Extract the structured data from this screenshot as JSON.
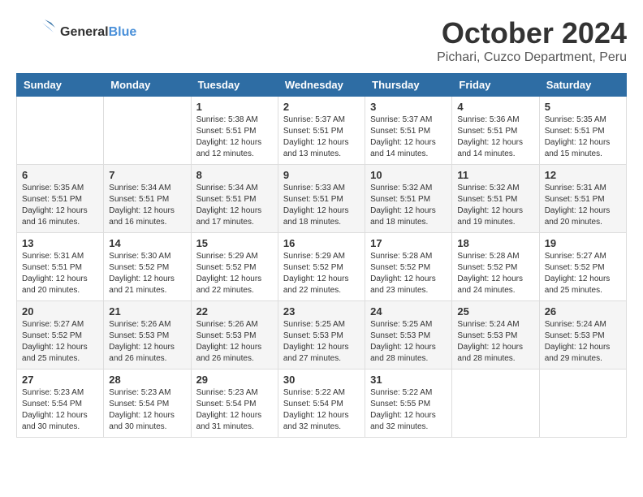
{
  "header": {
    "logo_general": "General",
    "logo_blue": "Blue",
    "month_title": "October 2024",
    "location": "Pichari, Cuzco Department, Peru"
  },
  "days_of_week": [
    "Sunday",
    "Monday",
    "Tuesday",
    "Wednesday",
    "Thursday",
    "Friday",
    "Saturday"
  ],
  "weeks": [
    [
      {
        "day": "",
        "sunrise": "",
        "sunset": "",
        "daylight": ""
      },
      {
        "day": "",
        "sunrise": "",
        "sunset": "",
        "daylight": ""
      },
      {
        "day": "1",
        "sunrise": "Sunrise: 5:38 AM",
        "sunset": "Sunset: 5:51 PM",
        "daylight": "Daylight: 12 hours and 12 minutes."
      },
      {
        "day": "2",
        "sunrise": "Sunrise: 5:37 AM",
        "sunset": "Sunset: 5:51 PM",
        "daylight": "Daylight: 12 hours and 13 minutes."
      },
      {
        "day": "3",
        "sunrise": "Sunrise: 5:37 AM",
        "sunset": "Sunset: 5:51 PM",
        "daylight": "Daylight: 12 hours and 14 minutes."
      },
      {
        "day": "4",
        "sunrise": "Sunrise: 5:36 AM",
        "sunset": "Sunset: 5:51 PM",
        "daylight": "Daylight: 12 hours and 14 minutes."
      },
      {
        "day": "5",
        "sunrise": "Sunrise: 5:35 AM",
        "sunset": "Sunset: 5:51 PM",
        "daylight": "Daylight: 12 hours and 15 minutes."
      }
    ],
    [
      {
        "day": "6",
        "sunrise": "Sunrise: 5:35 AM",
        "sunset": "Sunset: 5:51 PM",
        "daylight": "Daylight: 12 hours and 16 minutes."
      },
      {
        "day": "7",
        "sunrise": "Sunrise: 5:34 AM",
        "sunset": "Sunset: 5:51 PM",
        "daylight": "Daylight: 12 hours and 16 minutes."
      },
      {
        "day": "8",
        "sunrise": "Sunrise: 5:34 AM",
        "sunset": "Sunset: 5:51 PM",
        "daylight": "Daylight: 12 hours and 17 minutes."
      },
      {
        "day": "9",
        "sunrise": "Sunrise: 5:33 AM",
        "sunset": "Sunset: 5:51 PM",
        "daylight": "Daylight: 12 hours and 18 minutes."
      },
      {
        "day": "10",
        "sunrise": "Sunrise: 5:32 AM",
        "sunset": "Sunset: 5:51 PM",
        "daylight": "Daylight: 12 hours and 18 minutes."
      },
      {
        "day": "11",
        "sunrise": "Sunrise: 5:32 AM",
        "sunset": "Sunset: 5:51 PM",
        "daylight": "Daylight: 12 hours and 19 minutes."
      },
      {
        "day": "12",
        "sunrise": "Sunrise: 5:31 AM",
        "sunset": "Sunset: 5:51 PM",
        "daylight": "Daylight: 12 hours and 20 minutes."
      }
    ],
    [
      {
        "day": "13",
        "sunrise": "Sunrise: 5:31 AM",
        "sunset": "Sunset: 5:51 PM",
        "daylight": "Daylight: 12 hours and 20 minutes."
      },
      {
        "day": "14",
        "sunrise": "Sunrise: 5:30 AM",
        "sunset": "Sunset: 5:52 PM",
        "daylight": "Daylight: 12 hours and 21 minutes."
      },
      {
        "day": "15",
        "sunrise": "Sunrise: 5:29 AM",
        "sunset": "Sunset: 5:52 PM",
        "daylight": "Daylight: 12 hours and 22 minutes."
      },
      {
        "day": "16",
        "sunrise": "Sunrise: 5:29 AM",
        "sunset": "Sunset: 5:52 PM",
        "daylight": "Daylight: 12 hours and 22 minutes."
      },
      {
        "day": "17",
        "sunrise": "Sunrise: 5:28 AM",
        "sunset": "Sunset: 5:52 PM",
        "daylight": "Daylight: 12 hours and 23 minutes."
      },
      {
        "day": "18",
        "sunrise": "Sunrise: 5:28 AM",
        "sunset": "Sunset: 5:52 PM",
        "daylight": "Daylight: 12 hours and 24 minutes."
      },
      {
        "day": "19",
        "sunrise": "Sunrise: 5:27 AM",
        "sunset": "Sunset: 5:52 PM",
        "daylight": "Daylight: 12 hours and 25 minutes."
      }
    ],
    [
      {
        "day": "20",
        "sunrise": "Sunrise: 5:27 AM",
        "sunset": "Sunset: 5:52 PM",
        "daylight": "Daylight: 12 hours and 25 minutes."
      },
      {
        "day": "21",
        "sunrise": "Sunrise: 5:26 AM",
        "sunset": "Sunset: 5:53 PM",
        "daylight": "Daylight: 12 hours and 26 minutes."
      },
      {
        "day": "22",
        "sunrise": "Sunrise: 5:26 AM",
        "sunset": "Sunset: 5:53 PM",
        "daylight": "Daylight: 12 hours and 26 minutes."
      },
      {
        "day": "23",
        "sunrise": "Sunrise: 5:25 AM",
        "sunset": "Sunset: 5:53 PM",
        "daylight": "Daylight: 12 hours and 27 minutes."
      },
      {
        "day": "24",
        "sunrise": "Sunrise: 5:25 AM",
        "sunset": "Sunset: 5:53 PM",
        "daylight": "Daylight: 12 hours and 28 minutes."
      },
      {
        "day": "25",
        "sunrise": "Sunrise: 5:24 AM",
        "sunset": "Sunset: 5:53 PM",
        "daylight": "Daylight: 12 hours and 28 minutes."
      },
      {
        "day": "26",
        "sunrise": "Sunrise: 5:24 AM",
        "sunset": "Sunset: 5:53 PM",
        "daylight": "Daylight: 12 hours and 29 minutes."
      }
    ],
    [
      {
        "day": "27",
        "sunrise": "Sunrise: 5:23 AM",
        "sunset": "Sunset: 5:54 PM",
        "daylight": "Daylight: 12 hours and 30 minutes."
      },
      {
        "day": "28",
        "sunrise": "Sunrise: 5:23 AM",
        "sunset": "Sunset: 5:54 PM",
        "daylight": "Daylight: 12 hours and 30 minutes."
      },
      {
        "day": "29",
        "sunrise": "Sunrise: 5:23 AM",
        "sunset": "Sunset: 5:54 PM",
        "daylight": "Daylight: 12 hours and 31 minutes."
      },
      {
        "day": "30",
        "sunrise": "Sunrise: 5:22 AM",
        "sunset": "Sunset: 5:54 PM",
        "daylight": "Daylight: 12 hours and 32 minutes."
      },
      {
        "day": "31",
        "sunrise": "Sunrise: 5:22 AM",
        "sunset": "Sunset: 5:55 PM",
        "daylight": "Daylight: 12 hours and 32 minutes."
      },
      {
        "day": "",
        "sunrise": "",
        "sunset": "",
        "daylight": ""
      },
      {
        "day": "",
        "sunrise": "",
        "sunset": "",
        "daylight": ""
      }
    ]
  ]
}
